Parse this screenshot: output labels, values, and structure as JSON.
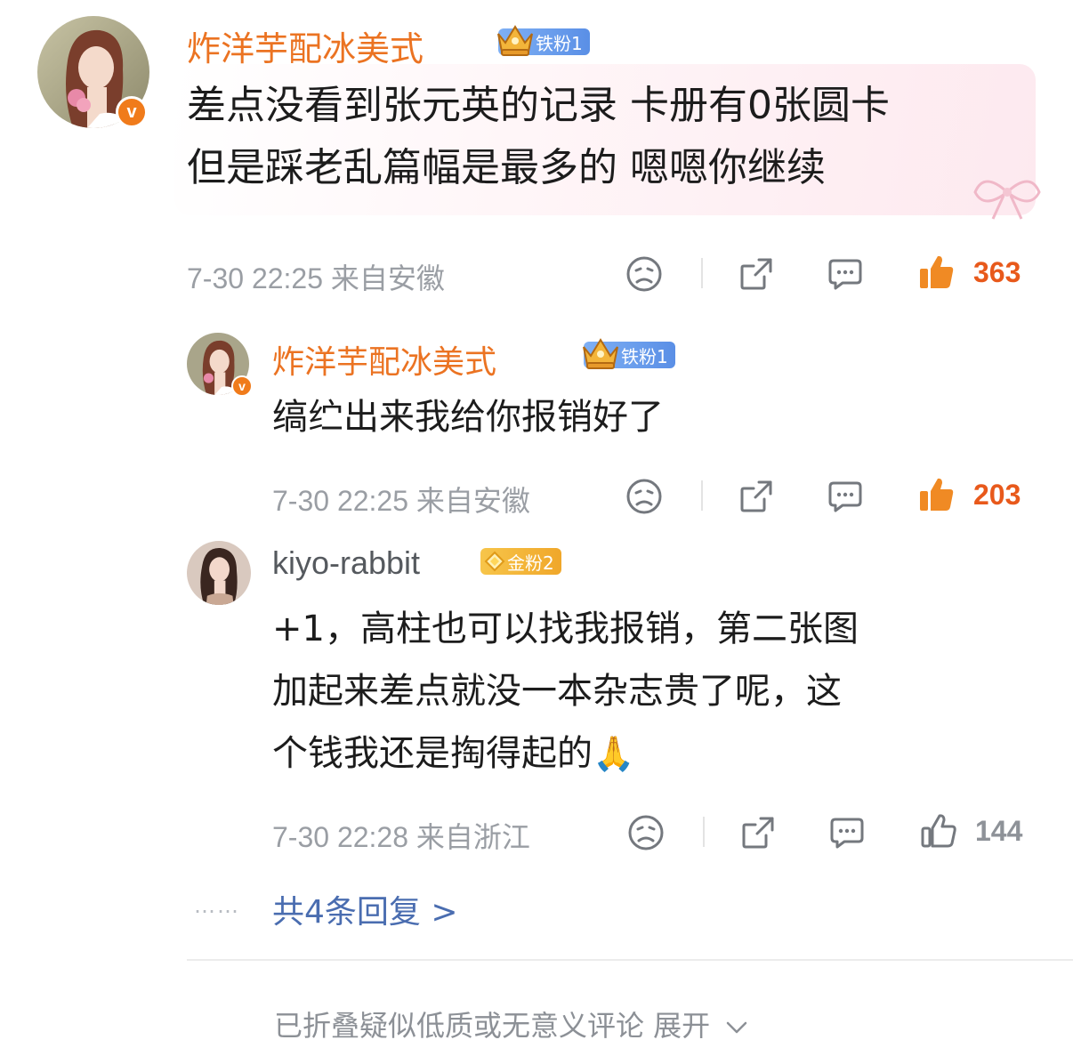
{
  "comment_main": {
    "username": "炸洋芋配冰美式",
    "fan_badge": "铁粉1",
    "text_line1": "差点没看到张元英的记录 卡册有0张圆卡",
    "text_line2": "但是踩老乱篇幅是最多的 嗯嗯你继续",
    "time": "7-30 22:25",
    "location": "来自安徽",
    "likes": "363",
    "verified_badge": "v"
  },
  "reply_1": {
    "username": "炸洋芋配冰美式",
    "fan_badge": "铁粉1",
    "text_line1": "缟纻出来我给你报销好了",
    "time": "7-30 22:25",
    "location": "来自安徽",
    "likes": "203",
    "verified_badge": "v"
  },
  "reply_2": {
    "username": "kiyo-rabbit",
    "fan_badge": "金粉2",
    "text_line1": "+1，高柱也可以找我报销，第二张图",
    "text_line2": "加起来差点就没一本杂志贵了呢，这",
    "text_line3": "个钱我还是掏得起的",
    "emoji": "🙏",
    "time": "7-30 22:28",
    "location": "来自浙江",
    "likes": "144"
  },
  "more_replies": "共4条回复 >",
  "more_dots": "……",
  "folded_notice": "已折叠疑似低质或无意义评论 展开",
  "colors": {
    "username_orange": "#eb7322",
    "like_active": "#e8591b",
    "link_blue": "#4a6db0",
    "meta_gray": "#9a9ea4"
  }
}
